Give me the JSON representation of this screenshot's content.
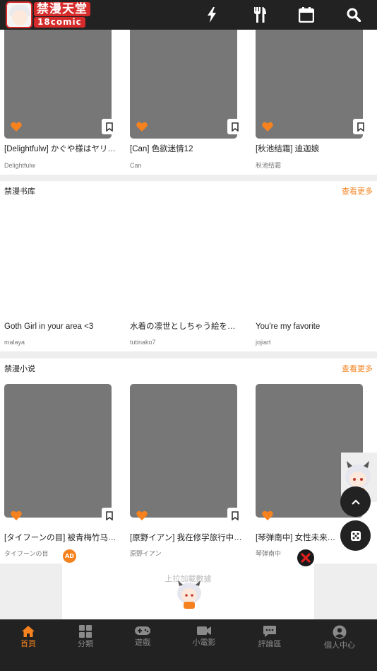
{
  "header": {
    "logo_title": "禁漫天堂",
    "logo_subtitle": "18comic",
    "icons": [
      "flash-icon",
      "utensils-icon",
      "calendar-icon",
      "search-icon"
    ]
  },
  "colors": {
    "accent": "#f5821f",
    "header_bg": "#222222",
    "thumb": "#777777"
  },
  "top_row": {
    "cards": [
      {
        "title": "[Delightfulw] かぐや様はヤリ…",
        "author": "Delightfulw"
      },
      {
        "title": "[Can] 色欲迷情12",
        "author": "Can"
      },
      {
        "title": "[秋池结霜] 迪迦娘",
        "author": "秋池结霜"
      }
    ]
  },
  "library": {
    "title": "禁漫书库",
    "more": "查看更多",
    "cards": [
      {
        "title": "Goth Girl in your area <3",
        "author": "malaya"
      },
      {
        "title": "水着の凛世としちゃう絵を…",
        "author": "tutinako7"
      },
      {
        "title": "You're my favorite",
        "author": "jojiart"
      }
    ]
  },
  "novel": {
    "title": "禁漫小说",
    "more": "查看更多",
    "cards": [
      {
        "title": "[タイフーンの目] 被青梅竹马…",
        "author": "タイフーンの目"
      },
      {
        "title": "[原野イアン] 我在修学旅行中…",
        "author": "原野イアン"
      },
      {
        "title": "[琴弹南中] 女性未来想照…",
        "author": "琴弹南中"
      }
    ]
  },
  "ad": {
    "badge": "AD",
    "loading_text": "上拉加載數據"
  },
  "bottom_nav": [
    {
      "label": "首頁",
      "icon": "home-icon",
      "active": true
    },
    {
      "label": "分類",
      "icon": "grid-icon",
      "active": false
    },
    {
      "label": "遊戲",
      "icon": "gamepad-icon",
      "active": false
    },
    {
      "label": "小電影",
      "icon": "video-icon",
      "active": false
    },
    {
      "label": "評論區",
      "icon": "comment-icon",
      "active": false
    },
    {
      "label": "個人中心",
      "icon": "user-icon",
      "active": false
    }
  ]
}
